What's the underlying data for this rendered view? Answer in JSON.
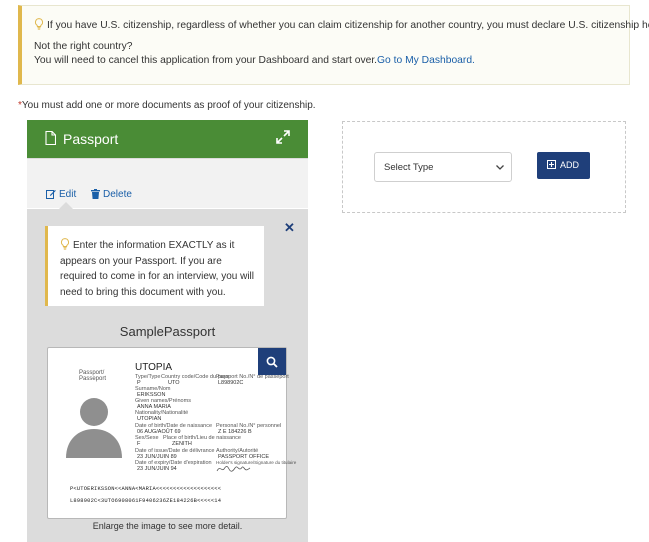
{
  "notice": {
    "line1": "If you have U.S. citizenship, regardless of whether you can claim citizenship for another country, you must declare U.S. citizenship here.",
    "line2": "Not the right country?",
    "line3_text": "You will need to cancel this application from your Dashboard and start over.",
    "line3_link": "Go to My Dashboard."
  },
  "required": {
    "star": "*",
    "text": "You must add one or more documents as proof of your citizenship."
  },
  "card": {
    "title": "Passport",
    "edit_label": "Edit",
    "delete_label": "Delete",
    "tip": "Enter the information EXACTLY as it appears on your Passport. If you are required to come in for an interview, you will need to bring this document with you.",
    "sample_title": "SamplePassport",
    "enlarge_text": "Enlarge the image to see more detail."
  },
  "passport": {
    "country": "UTOPIA",
    "side_label": "Passport/\nPasseport",
    "type_label": "Type/Type",
    "type_value": "P",
    "country_code_label": "Country code/Code du pays",
    "country_code_value": "UTO",
    "passport_no_label": "Passport No./N° de passeport",
    "passport_no_value": "L898902C",
    "surname_label": "Surname/Nom",
    "surname_value": "ERIKSSON",
    "given_names_label": "Given names/Prénoms",
    "given_names_value": "ANNA MARIA",
    "nationality_label": "Nationality/Nationalité",
    "nationality_value": "UTOPIAN",
    "dob_label": "Date of birth/Date de naissance",
    "dob_value": "06 AUG/AOÛT 69",
    "personal_no_label": "Personal No./N° personnel",
    "personal_no_value": "Z E 184226 B",
    "sex_label": "Sex/Sexe",
    "sex_value": "F",
    "pob_label": "Place of birth/Lieu de naissance",
    "pob_value": "ZENITH",
    "doi_label": "Date of issue/Date de délivrance",
    "doi_value": "23 JUN/JUIN 89",
    "authority_label": "Authority/Autorité",
    "authority_value": "PASSPORT OFFICE",
    "doe_label": "Date of expiry/Date d'expiration",
    "doe_value": "23 JUN/JUIN 94",
    "signature_label": "Holder's signature/Signature du titulaire",
    "mrz1": "P<UTOERIKSSON<<ANNA<MARIA<<<<<<<<<<<<<<<<<<<",
    "mrz2": "L898902C<3UTO6908061F9406236ZE184226B<<<<<14"
  },
  "add_panel": {
    "select_value": "Select Type",
    "add_label": "ADD"
  },
  "colors": {
    "card_header": "#4a8c36",
    "primary_button": "#1f3f7a",
    "link": "#1a5fa8",
    "notice_accent": "#e0b84d"
  }
}
